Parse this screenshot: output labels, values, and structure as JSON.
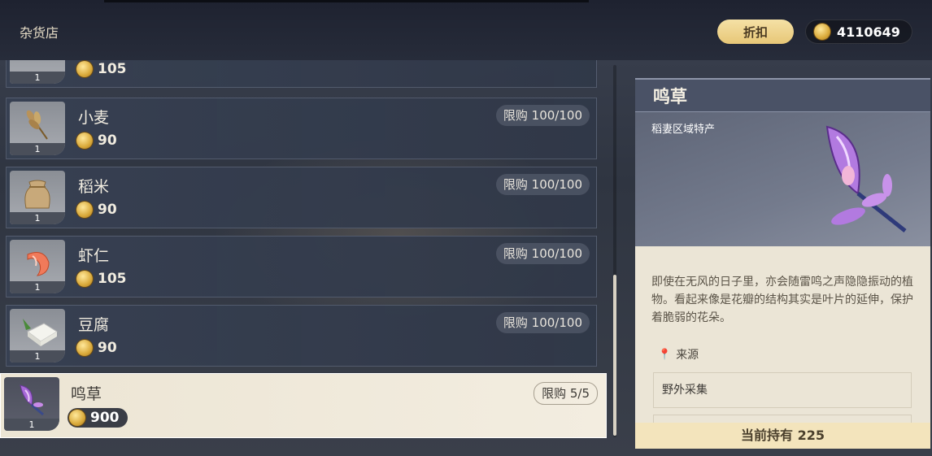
{
  "header": {
    "title": "杂货店",
    "discount_label": "折扣",
    "currency": "4110649"
  },
  "items": [
    {
      "name": "",
      "price": "105",
      "qty": "1",
      "limit": "",
      "icon": "bowl-icon"
    },
    {
      "name": "小麦",
      "price": "90",
      "qty": "1",
      "limit": "限购 100/100",
      "icon": "wheat-icon"
    },
    {
      "name": "稻米",
      "price": "90",
      "qty": "1",
      "limit": "限购 100/100",
      "icon": "rice-sack-icon"
    },
    {
      "name": "虾仁",
      "price": "105",
      "qty": "1",
      "limit": "限购 100/100",
      "icon": "shrimp-icon"
    },
    {
      "name": "豆腐",
      "price": "90",
      "qty": "1",
      "limit": "限购 100/100",
      "icon": "tofu-icon"
    },
    {
      "name": "鸣草",
      "price": "900",
      "qty": "1",
      "limit": "限购 5/5",
      "icon": "naku-weed-icon",
      "selected": true
    }
  ],
  "detail": {
    "title": "鸣草",
    "region": "稻妻区域特产",
    "description": "即使在无风的日子里，亦会随雷鸣之声隐隐振动的植物。看起来像是花瓣的结构其实是叶片的延伸，保护着脆弱的花朵。",
    "source_label": "来源",
    "source_item": "野外采集",
    "owned": "当前持有 225"
  }
}
